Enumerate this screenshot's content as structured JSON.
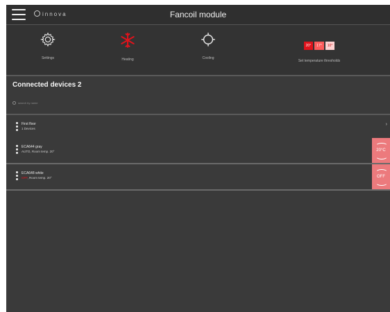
{
  "header": {
    "brand": "innova",
    "title": "Fancoil module"
  },
  "modes": [
    {
      "label": "Settings",
      "icon": "gear-icon"
    },
    {
      "label": "Heating",
      "icon": "snowflake-icon",
      "color": "#e0131c"
    },
    {
      "label": "Cooling",
      "icon": "sun-icon"
    },
    {
      "label": "Set temperature thresholds",
      "values": [
        "20°",
        "17°",
        "10°"
      ]
    }
  ],
  "devices": {
    "title": "Connected devices 2",
    "search_placeholder": "search by name"
  },
  "groups": [
    {
      "name": "First floor",
      "sub": "1 Devices"
    }
  ],
  "device_list": [
    {
      "name": "ECA644 gray",
      "mode": "AUTO",
      "temp": ", Room temp. 20°",
      "tile": "20°C"
    },
    {
      "name": "ECA648 white",
      "mode": "OFF",
      "temp": ", Room temp. 20°",
      "tile": "OFF"
    }
  ]
}
